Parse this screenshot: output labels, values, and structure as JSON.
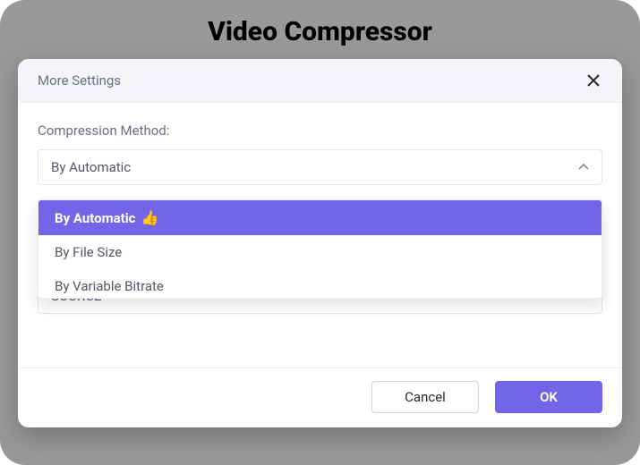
{
  "page": {
    "title": "Video Compressor"
  },
  "modal": {
    "title": "More Settings",
    "compression_method_label": "Compression Method:",
    "compression_method_value": "By Automatic",
    "dropdown": {
      "options": [
        {
          "label": "By Automatic"
        },
        {
          "label": "By File Size"
        },
        {
          "label": "By Variable Bitrate"
        }
      ]
    },
    "source_value": "SOURCE",
    "cancel_label": "Cancel",
    "ok_label": "OK"
  },
  "colors": {
    "accent": "#7365E8"
  }
}
